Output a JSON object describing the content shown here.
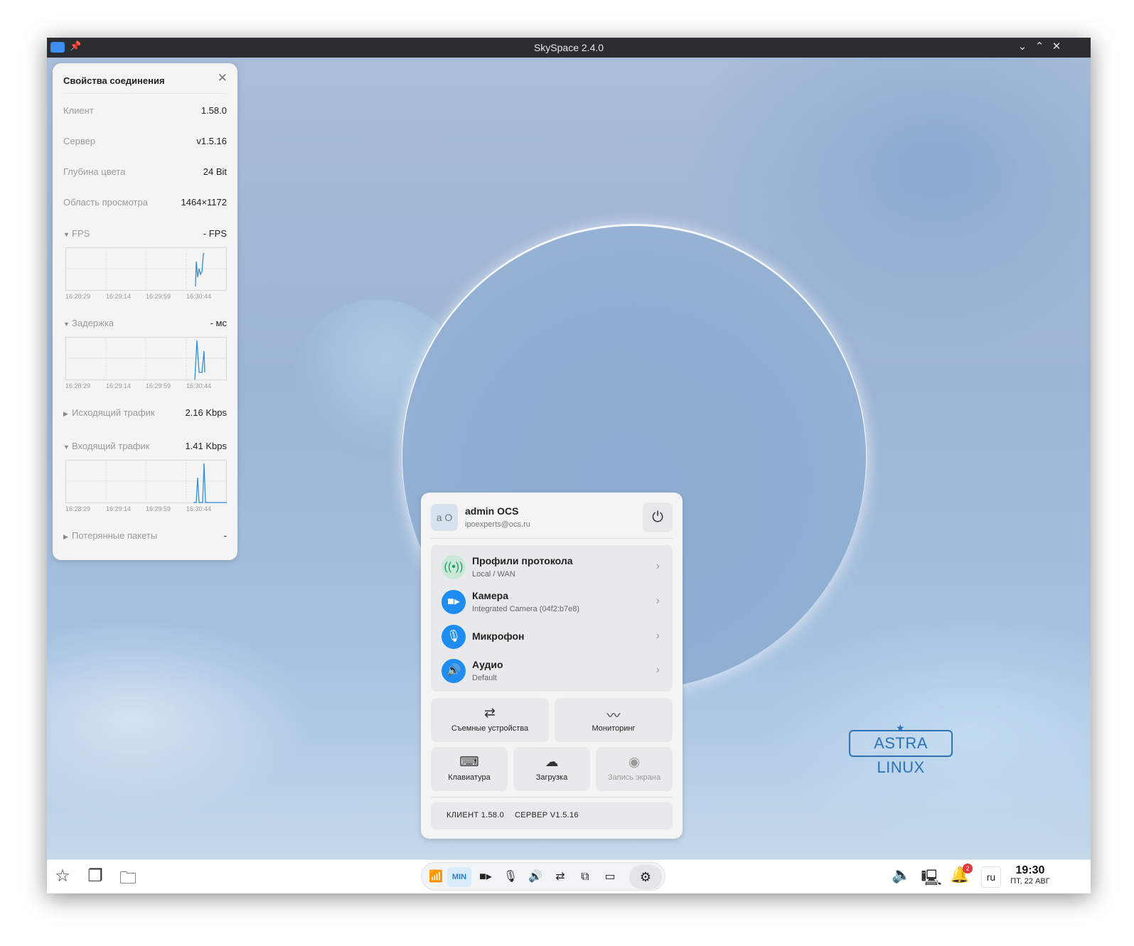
{
  "window": {
    "title": "SkySpace 2.4.0",
    "icons": [
      "app-icon",
      "pin-icon",
      "minimize-icon",
      "maximize-icon",
      "close-icon"
    ]
  },
  "connection": {
    "title": "Свойства соединения",
    "client_label": "Клиент",
    "client_value": "1.58.0",
    "server_label": "Сервер",
    "server_value": "v1.5.16",
    "depth_label": "Глубина цвета",
    "depth_value": "24 Bit",
    "viewport_label": "Область просмотра",
    "viewport_value": "1464×1172",
    "fps_label": "FPS",
    "fps_value": "- FPS",
    "latency_label": "Задержка",
    "latency_value": "- мс",
    "out_label": "Исходящий трафик",
    "out_value": "2.16 Kbps",
    "in_label": "Входящий трафик",
    "in_value": "1.41 Kbps",
    "lost_label": "Потерянные пакеты",
    "lost_value": "-",
    "graph_times": [
      "16:28:29",
      "16:29:14",
      "16:29:59",
      "16:30:44"
    ]
  },
  "menu": {
    "avatar": "a O",
    "user_name": "admin OCS",
    "user_email": "ipoexperts@ocs.ru",
    "items": [
      {
        "title": "Профили протокола",
        "subtitle": "Local / WAN",
        "icon": "antenna-icon"
      },
      {
        "title": "Камера",
        "subtitle": "Integrated Camera (04f2:b7e8)",
        "icon": "camera-icon"
      },
      {
        "title": "Микрофон",
        "subtitle": "",
        "icon": "microphone-icon"
      },
      {
        "title": "Аудио",
        "subtitle": "Default",
        "icon": "speaker-icon"
      }
    ],
    "tiles": {
      "removable": "Съемные устройства",
      "monitoring": "Мониторинг",
      "keyboard": "Клавиатура",
      "upload": "Загрузка",
      "record": "Запись экрана"
    },
    "client_version": "КЛИЕНТ 1.58.0",
    "server_version": "СЕРВЕР V1.5.16"
  },
  "desktop": {
    "logo": "ASTRA LINUX"
  },
  "taskbar": {
    "dock_min": "MIN",
    "language": "ru",
    "time": "19:30",
    "date": "ПТ, 22 АВГ",
    "notifications": "2"
  }
}
